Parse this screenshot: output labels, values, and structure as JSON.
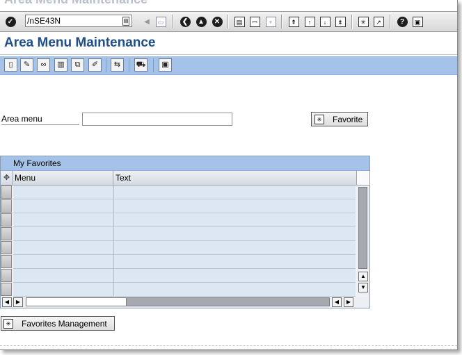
{
  "window": {
    "faded_title": "Area Menu Maintenance"
  },
  "system_toolbar": {
    "command_field_value": "/nSE43N"
  },
  "title_bar": {
    "title": "Area Menu Maintenance"
  },
  "form": {
    "area_menu_label": "Area menu",
    "area_menu_value": "",
    "favorite_button": "Favorite"
  },
  "favorites_table": {
    "caption": "My Favorites",
    "columns": [
      "Menu",
      "Text"
    ],
    "rows": [
      {
        "menu": "",
        "text": ""
      },
      {
        "menu": "",
        "text": ""
      },
      {
        "menu": "",
        "text": ""
      },
      {
        "menu": "",
        "text": ""
      },
      {
        "menu": "",
        "text": ""
      },
      {
        "menu": "",
        "text": ""
      },
      {
        "menu": "",
        "text": ""
      },
      {
        "menu": "",
        "text": ""
      }
    ]
  },
  "favorites_management_button": "Favorites Management",
  "icons": {
    "enter": "check-icon",
    "save": "save-icon",
    "back": "back-icon",
    "exit": "exit-icon",
    "cancel": "cancel-icon",
    "print": "print-icon",
    "find": "find-icon",
    "find_next": "find-next-icon",
    "first_page": "first-page-icon",
    "prev_page": "previous-page-icon",
    "next_page": "next-page-icon",
    "last_page": "last-page-icon",
    "create_session": "create-session-icon",
    "shortcut": "shortcut-icon",
    "help": "help-icon",
    "layout": "layout-icon"
  }
}
